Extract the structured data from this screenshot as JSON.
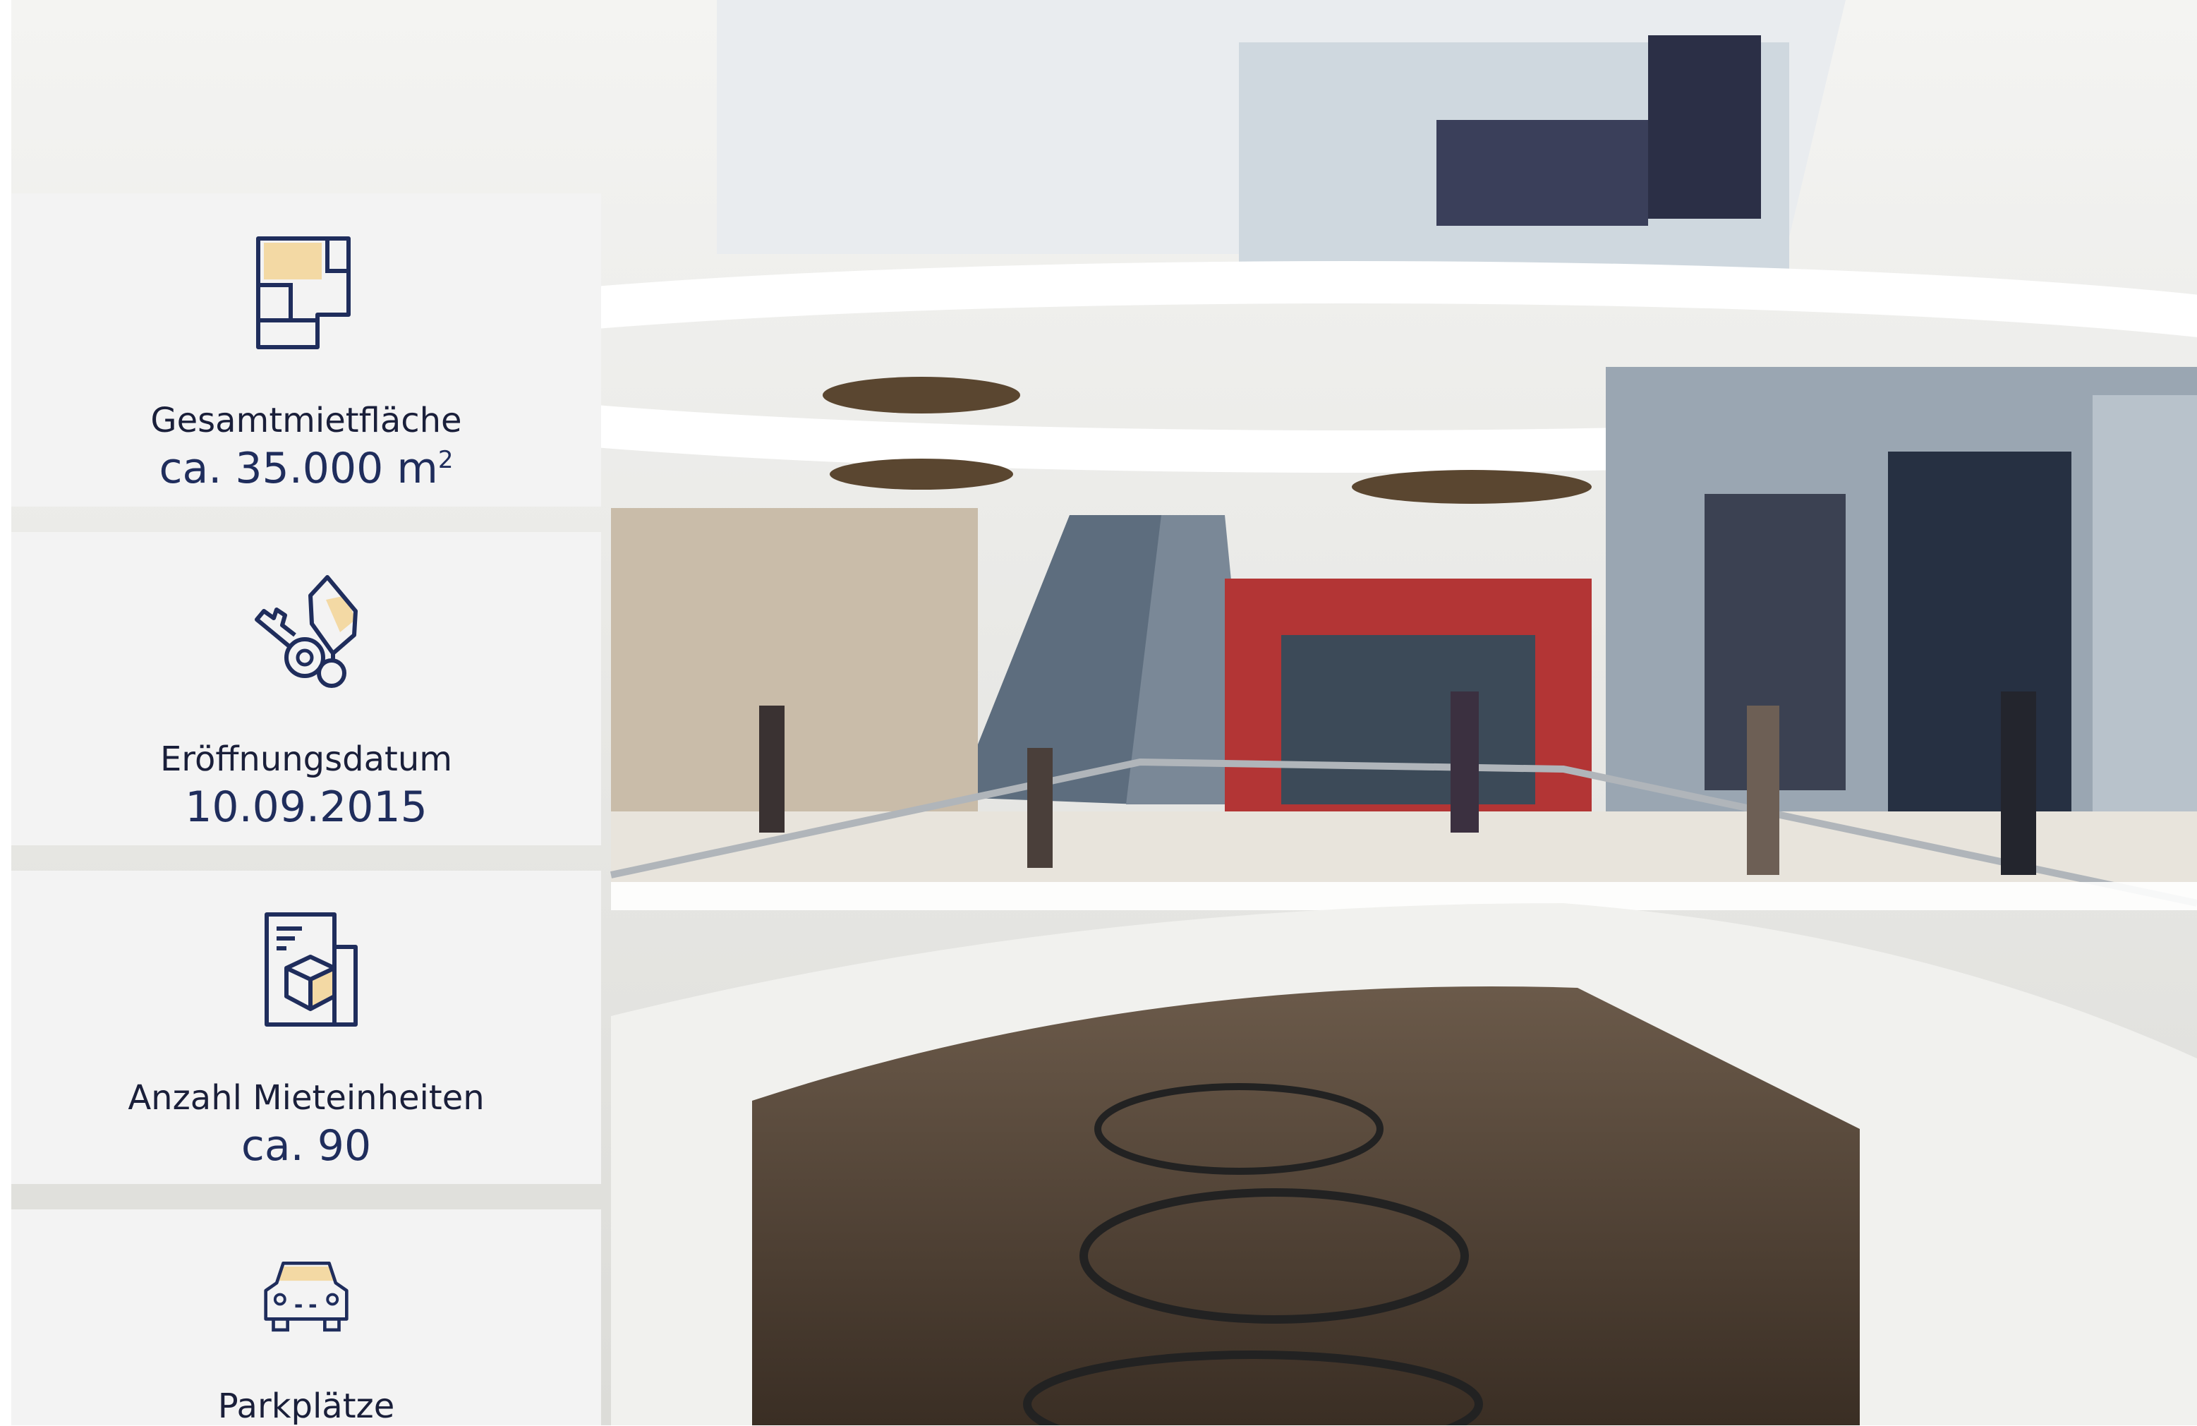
{
  "colors": {
    "card_background": "#f3f3f3",
    "icon_stroke": "#1f2d5c",
    "icon_accent": "#f3d9a4",
    "label_text": "#1a1f3a"
  },
  "facts": [
    {
      "icon": "floor-plan-icon",
      "label": "Gesamtmietfläche",
      "value": "ca. 35.000 m",
      "value_sup": "2"
    },
    {
      "icon": "key-icon",
      "label": "Eröffnungsdatum",
      "value": "10.09.2015"
    },
    {
      "icon": "documents-box-icon",
      "label": "Anzahl Mieteinheiten",
      "value": "ca. 90"
    },
    {
      "icon": "car-icon",
      "label": "Parkplätze"
    }
  ]
}
